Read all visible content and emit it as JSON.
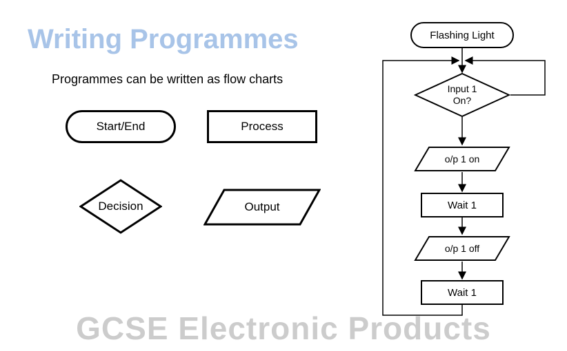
{
  "title": "Writing Programmes",
  "subtitle": "Programmes can be written as flow charts",
  "footer": "GCSE Electronic Products",
  "legend": {
    "startEnd": "Start/End",
    "process": "Process",
    "decision": "Decision",
    "output": "Output"
  },
  "flowchart": {
    "start": "Flashing Light",
    "decision": "Input 1\nOn?",
    "out_on": "o/p 1 on",
    "wait1": "Wait 1",
    "out_off": "o/p 1 off",
    "wait2": "Wait 1"
  }
}
